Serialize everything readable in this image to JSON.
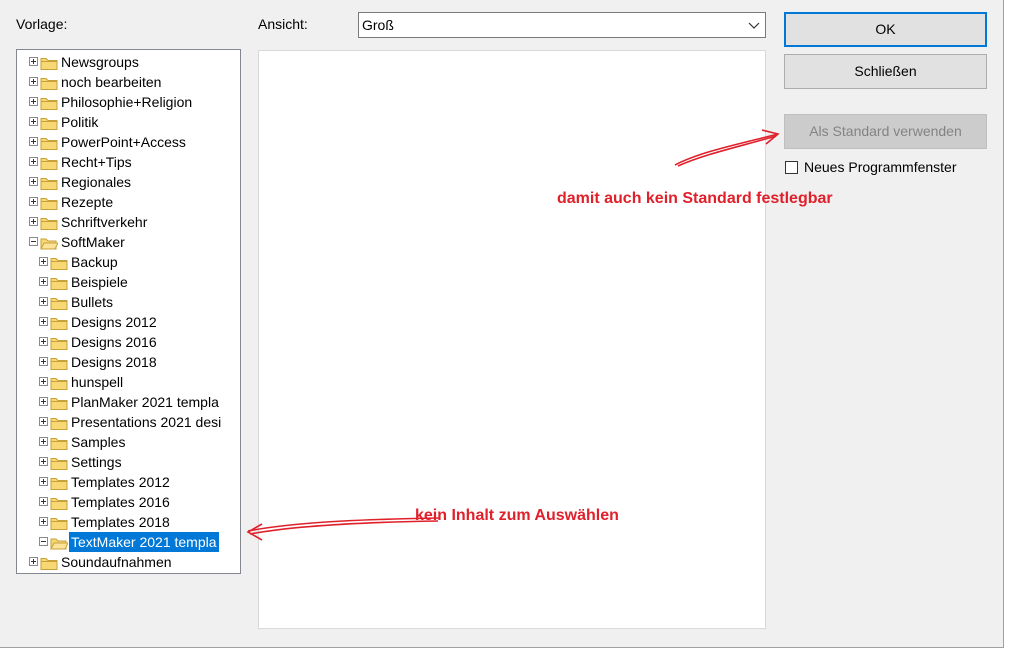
{
  "labels": {
    "vorlage": "Vorlage:",
    "ansicht": "Ansicht:"
  },
  "view_select": {
    "value": "Groß"
  },
  "buttons": {
    "ok": "OK",
    "close": "Schließen",
    "set_default": "Als Standard verwenden"
  },
  "checkbox": {
    "label": "Neues Programmfenster",
    "checked": false
  },
  "tree": {
    "items": [
      {
        "label": "Newsgroups",
        "level": 0,
        "state": "collapsed"
      },
      {
        "label": "noch bearbeiten",
        "level": 0,
        "state": "collapsed"
      },
      {
        "label": "Philosophie+Religion",
        "level": 0,
        "state": "collapsed"
      },
      {
        "label": "Politik",
        "level": 0,
        "state": "collapsed"
      },
      {
        "label": "PowerPoint+Access",
        "level": 0,
        "state": "collapsed"
      },
      {
        "label": "Recht+Tips",
        "level": 0,
        "state": "collapsed"
      },
      {
        "label": "Regionales",
        "level": 0,
        "state": "collapsed"
      },
      {
        "label": "Rezepte",
        "level": 0,
        "state": "collapsed"
      },
      {
        "label": "Schriftverkehr",
        "level": 0,
        "state": "collapsed"
      },
      {
        "label": "SoftMaker",
        "level": 0,
        "state": "expanded"
      },
      {
        "label": "Backup",
        "level": 1,
        "state": "collapsed"
      },
      {
        "label": "Beispiele",
        "level": 1,
        "state": "collapsed"
      },
      {
        "label": "Bullets",
        "level": 1,
        "state": "collapsed"
      },
      {
        "label": "Designs 2012",
        "level": 1,
        "state": "collapsed"
      },
      {
        "label": "Designs 2016",
        "level": 1,
        "state": "collapsed"
      },
      {
        "label": "Designs 2018",
        "level": 1,
        "state": "collapsed"
      },
      {
        "label": "hunspell",
        "level": 1,
        "state": "collapsed"
      },
      {
        "label": "PlanMaker 2021 templa",
        "level": 1,
        "state": "collapsed"
      },
      {
        "label": "Presentations 2021 desi",
        "level": 1,
        "state": "collapsed"
      },
      {
        "label": "Samples",
        "level": 1,
        "state": "collapsed"
      },
      {
        "label": "Settings",
        "level": 1,
        "state": "collapsed"
      },
      {
        "label": "Templates 2012",
        "level": 1,
        "state": "collapsed"
      },
      {
        "label": "Templates 2016",
        "level": 1,
        "state": "collapsed"
      },
      {
        "label": "Templates 2018",
        "level": 1,
        "state": "collapsed"
      },
      {
        "label": "TextMaker 2021 templa",
        "level": 1,
        "state": "expanded",
        "selected": true
      },
      {
        "label": "Soundaufnahmen",
        "level": 0,
        "state": "collapsed"
      }
    ]
  },
  "annotations": {
    "default_note": "damit auch kein Standard festlegbar",
    "content_note": "kein Inhalt zum Auswählen"
  },
  "colors": {
    "annotation": "#e0202a",
    "selection": "#0078d7",
    "folder_fill": "#f8d775",
    "folder_stroke": "#c9a13a"
  }
}
